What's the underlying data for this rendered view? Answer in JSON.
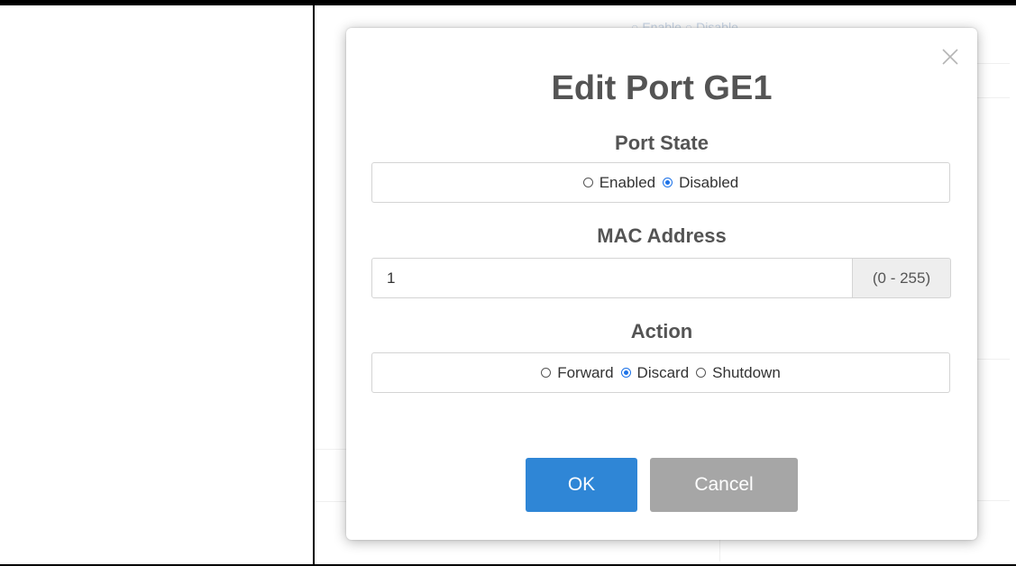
{
  "background": {
    "fragment_text": "○ Enable   ○ Disable"
  },
  "modal": {
    "title": "Edit Port GE1",
    "close_icon": "close-icon",
    "port_state": {
      "label": "Port State",
      "options": [
        "Enabled",
        "Disabled"
      ],
      "selected": "Disabled"
    },
    "mac_address": {
      "label": "MAC Address",
      "value": "1",
      "range_hint": "(0 - 255)"
    },
    "action": {
      "label": "Action",
      "options": [
        "Forward",
        "Discard",
        "Shutdown"
      ],
      "selected": "Discard"
    },
    "buttons": {
      "ok_label": "OK",
      "cancel_label": "Cancel"
    }
  },
  "colors": {
    "accent": "#2f86d6",
    "cancel": "#a6a6a6",
    "radio_checked": "#1e73e8"
  }
}
